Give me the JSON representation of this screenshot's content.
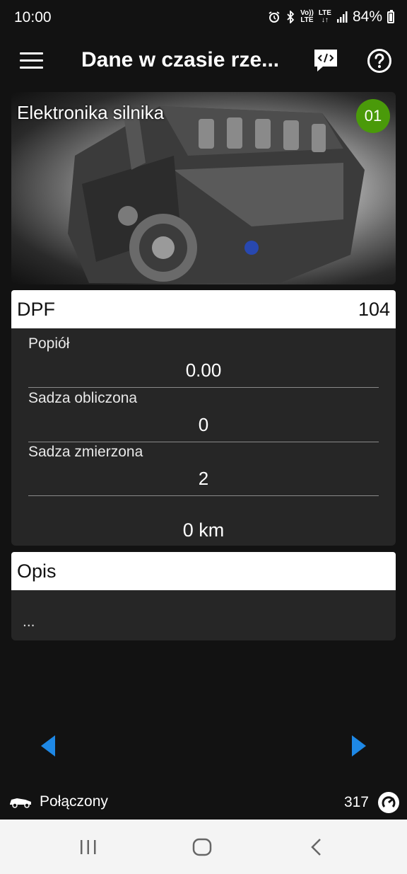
{
  "status": {
    "time": "10:00",
    "network": "LTE",
    "volte_top": "Vo))",
    "volte_bottom": "LTE",
    "battery": "84%"
  },
  "app_bar": {
    "title": "Dane w czasie rze..."
  },
  "hero": {
    "title": "Elektronika silnika",
    "badge": "01"
  },
  "dpf_card": {
    "title": "DPF",
    "code": "104",
    "params": [
      {
        "label": "Popiół",
        "value": "0.00"
      },
      {
        "label": "Sadza obliczona",
        "value": "0"
      },
      {
        "label": "Sadza zmierzona",
        "value": "2"
      }
    ],
    "distance": "0 km"
  },
  "desc_card": {
    "title": "Opis",
    "text": "..."
  },
  "footer": {
    "status": "Połączony",
    "count": "317"
  },
  "colors": {
    "badge": "#4a9a0a",
    "arrow": "#1e88e5",
    "card_body": "#262626"
  }
}
